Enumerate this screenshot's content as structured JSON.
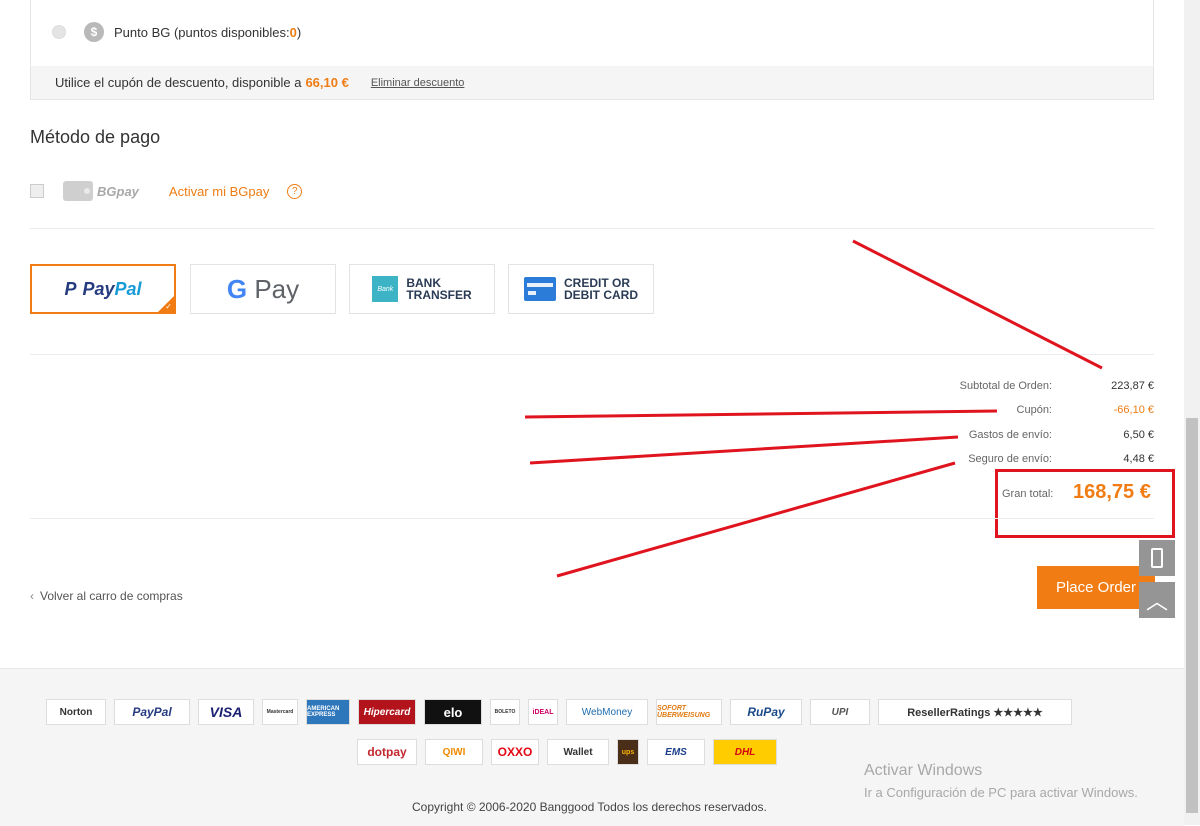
{
  "points": {
    "label": "Punto BG (puntos disponibles: ",
    "count": "0",
    "suffix": " )",
    "coin_icon": "dollar-coin-icon"
  },
  "coupon": {
    "text": "Utilice el cupón de descuento, disponible a ",
    "amount": "66,10 €",
    "remove_link": "Eliminar descuento"
  },
  "payment": {
    "title": "Método de pago",
    "bgpay_label": "BGpay",
    "activate_link": "Activar mi BGpay",
    "help_icon": "?",
    "methods": {
      "paypal": {
        "pay": "Pay",
        "pal": "Pal",
        "mark": "P"
      },
      "gpay": {
        "g": "G",
        "pay": "Pay"
      },
      "bank": {
        "line1": "BANK",
        "line2": "TRANSFER",
        "icon_text": "Bank"
      },
      "card": {
        "line1": "CREDIT OR",
        "line2": "DEBIT CARD"
      }
    }
  },
  "summary": {
    "subtotal_label": "Subtotal de Orden:",
    "subtotal_value": "223,87 €",
    "coupon_label": "Cupón:",
    "coupon_value": "-66,10 €",
    "shipping_label": "Gastos de envío:",
    "shipping_value": "6,50 €",
    "insurance_label": "Seguro de envío:",
    "insurance_value": "4,48 €",
    "grand_label": "Gran total:",
    "grand_value": "168,75 €"
  },
  "actions": {
    "back_link": "Volver al carro de compras",
    "place_order": "Place Order"
  },
  "footer": {
    "logos_row1": [
      "Norton",
      "PayPal",
      "VISA",
      "Mastercard",
      "AMERICAN EXPRESS",
      "Hipercard",
      "elo",
      "BOLETO",
      "iDEAL",
      "WebMoney",
      "SOFORT ÜBERWEISUNG",
      "RuPay",
      "UPI",
      "ResellerRatings ★★★★★"
    ],
    "logos_row2": [
      "dotpay",
      "QIWI",
      "OXXO",
      "Wallet",
      "ups",
      "EMS",
      "DHL"
    ],
    "copyright": "Copyright © 2006-2020 Banggood Todos los derechos reservados."
  },
  "windows": {
    "title": "Activar Windows",
    "subtitle": "Ir a Configuración de PC para activar Windows."
  },
  "colors": {
    "accent": "#f07c13",
    "annotation_red": "#e0141e"
  }
}
